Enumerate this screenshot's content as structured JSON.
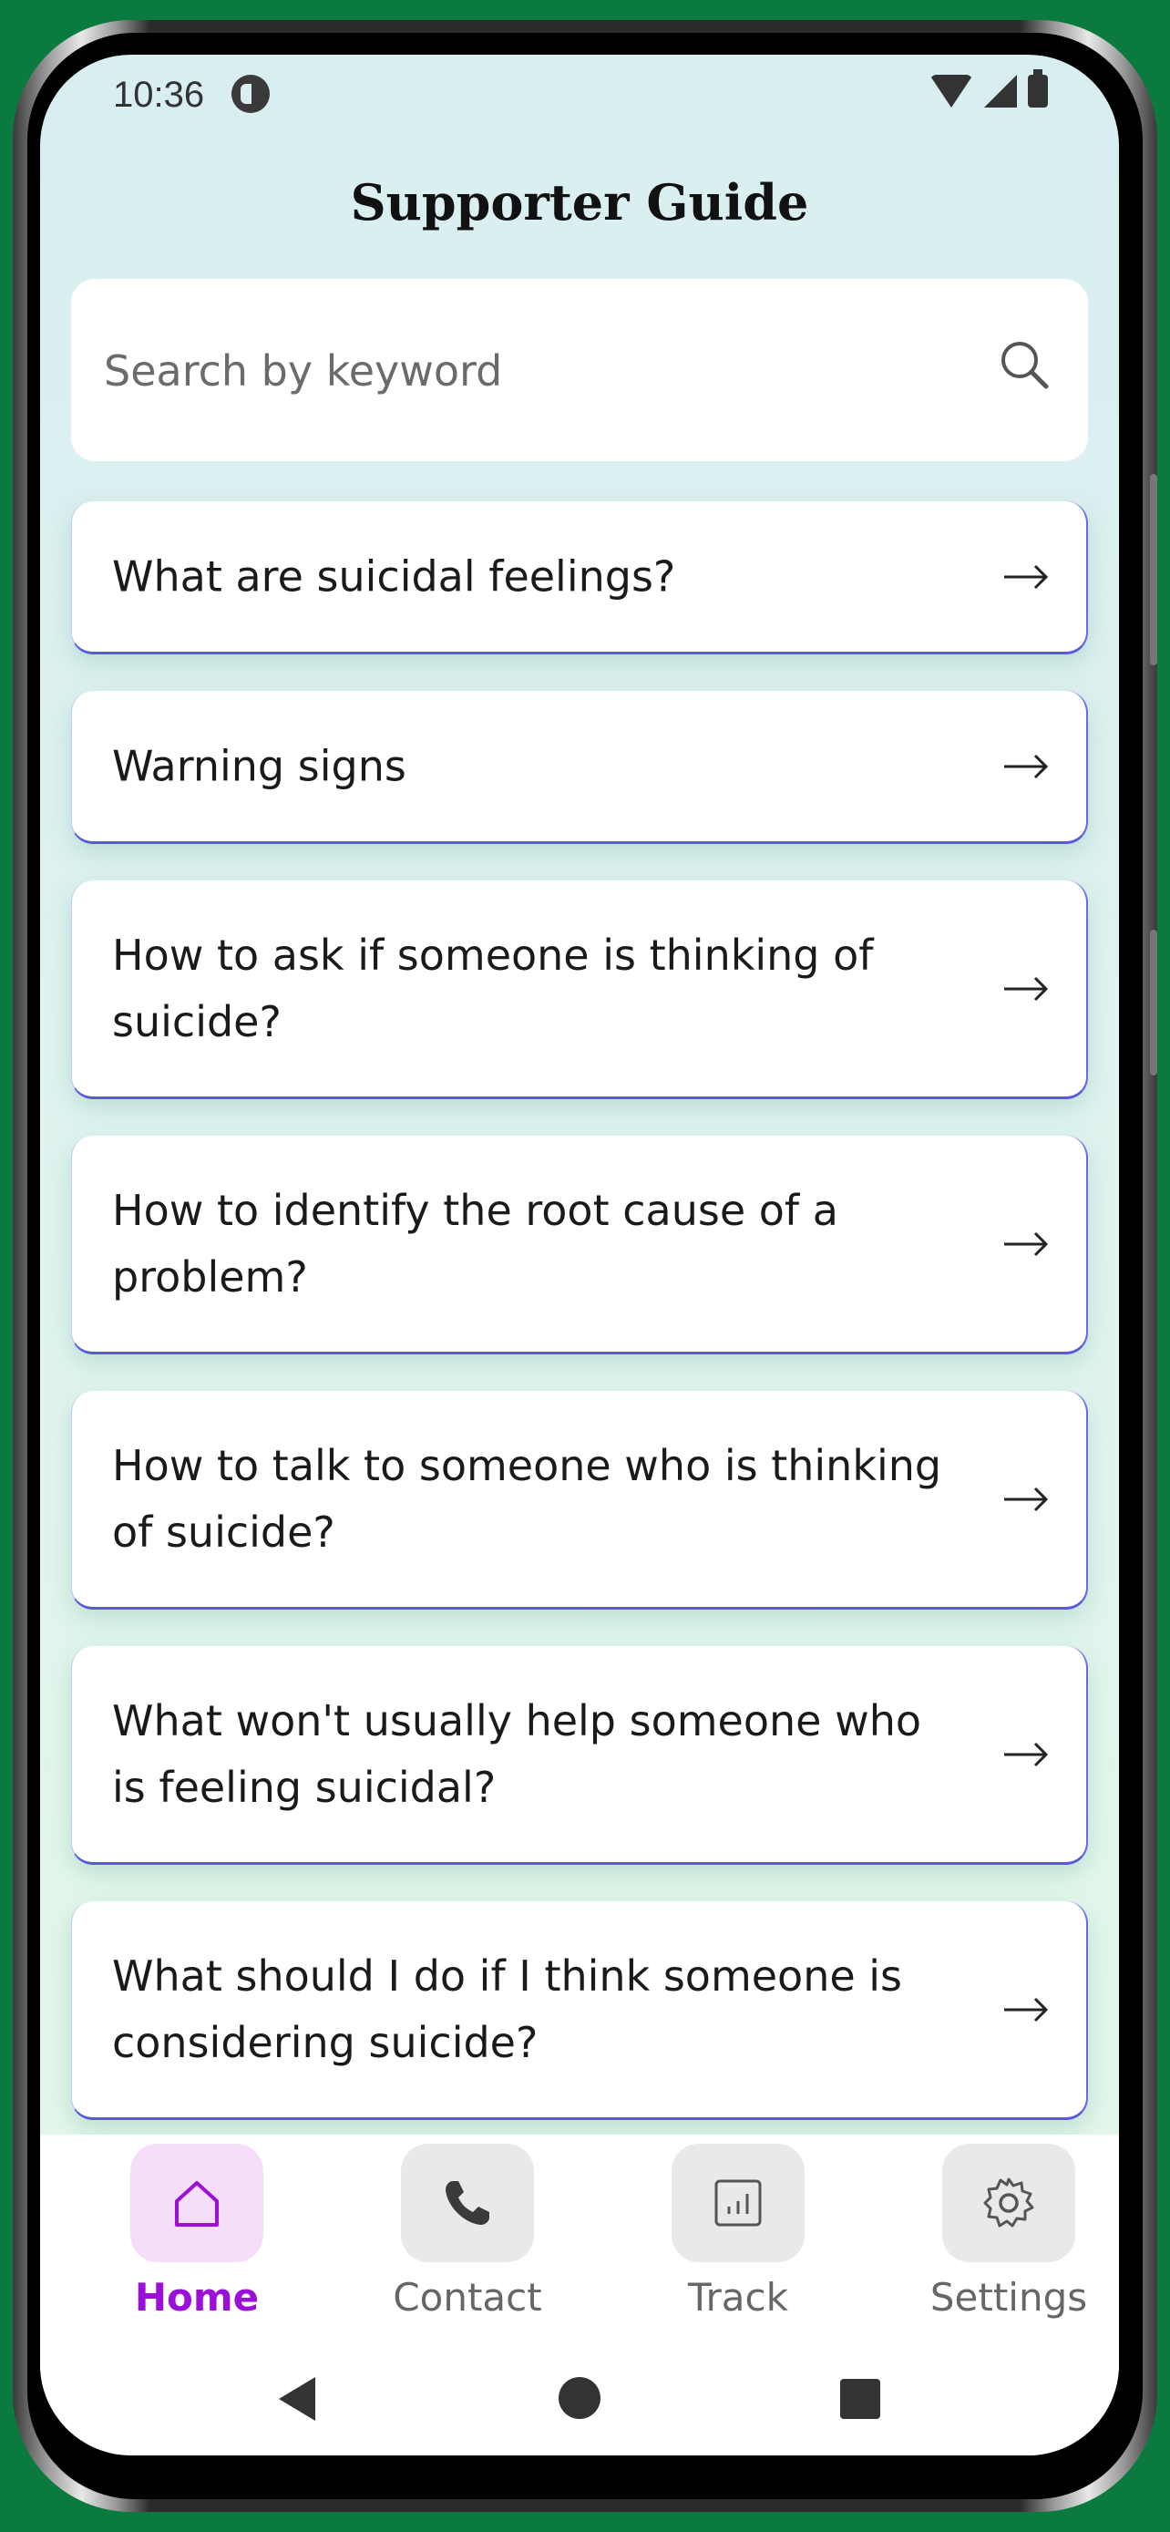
{
  "status_bar": {
    "time": "10:36"
  },
  "header": {
    "title": "Supporter Guide"
  },
  "search": {
    "placeholder": "Search by keyword"
  },
  "guide_items": [
    {
      "label": "What are suicidal feelings?"
    },
    {
      "label": "Warning signs"
    },
    {
      "label": "How to ask if someone is thinking of suicide?"
    },
    {
      "label": "How to identify the root cause of a problem?"
    },
    {
      "label": "How to talk to someone who is thinking of suicide?"
    },
    {
      "label": "What won't usually help someone who is feeling suicidal?"
    },
    {
      "label": "What should I do if I think someone is considering suicide?"
    }
  ],
  "bottom_nav": {
    "items": [
      {
        "label": "Home",
        "icon": "home-icon",
        "active": true
      },
      {
        "label": "Contact",
        "icon": "phone-icon",
        "active": false
      },
      {
        "label": "Track",
        "icon": "chart-icon",
        "active": false
      },
      {
        "label": "Settings",
        "icon": "gear-icon",
        "active": false
      }
    ]
  },
  "colors": {
    "accent": "#9b10d8",
    "card_border": "#5a5ae0",
    "frame_background": "#0a7a3e"
  }
}
